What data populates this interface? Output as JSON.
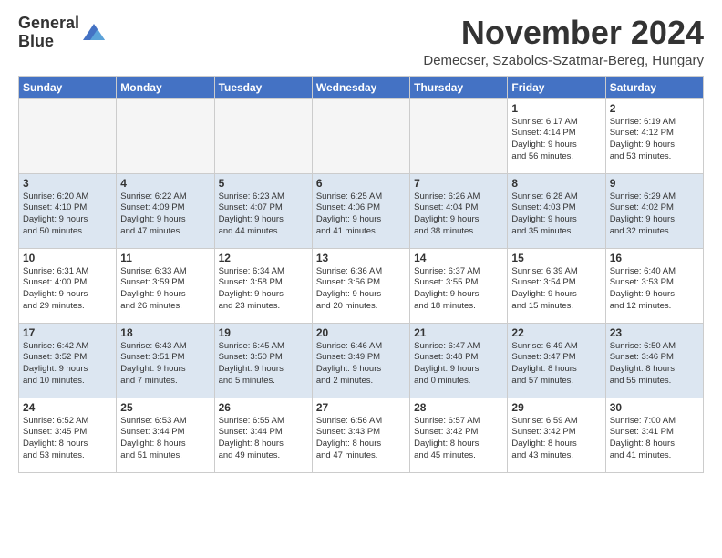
{
  "header": {
    "logo_line1": "General",
    "logo_line2": "Blue",
    "month": "November 2024",
    "location": "Demecser, Szabolcs-Szatmar-Bereg, Hungary"
  },
  "weekdays": [
    "Sunday",
    "Monday",
    "Tuesday",
    "Wednesday",
    "Thursday",
    "Friday",
    "Saturday"
  ],
  "weeks": [
    [
      {
        "day": "",
        "info": ""
      },
      {
        "day": "",
        "info": ""
      },
      {
        "day": "",
        "info": ""
      },
      {
        "day": "",
        "info": ""
      },
      {
        "day": "",
        "info": ""
      },
      {
        "day": "1",
        "info": "Sunrise: 6:17 AM\nSunset: 4:14 PM\nDaylight: 9 hours\nand 56 minutes."
      },
      {
        "day": "2",
        "info": "Sunrise: 6:19 AM\nSunset: 4:12 PM\nDaylight: 9 hours\nand 53 minutes."
      }
    ],
    [
      {
        "day": "3",
        "info": "Sunrise: 6:20 AM\nSunset: 4:10 PM\nDaylight: 9 hours\nand 50 minutes."
      },
      {
        "day": "4",
        "info": "Sunrise: 6:22 AM\nSunset: 4:09 PM\nDaylight: 9 hours\nand 47 minutes."
      },
      {
        "day": "5",
        "info": "Sunrise: 6:23 AM\nSunset: 4:07 PM\nDaylight: 9 hours\nand 44 minutes."
      },
      {
        "day": "6",
        "info": "Sunrise: 6:25 AM\nSunset: 4:06 PM\nDaylight: 9 hours\nand 41 minutes."
      },
      {
        "day": "7",
        "info": "Sunrise: 6:26 AM\nSunset: 4:04 PM\nDaylight: 9 hours\nand 38 minutes."
      },
      {
        "day": "8",
        "info": "Sunrise: 6:28 AM\nSunset: 4:03 PM\nDaylight: 9 hours\nand 35 minutes."
      },
      {
        "day": "9",
        "info": "Sunrise: 6:29 AM\nSunset: 4:02 PM\nDaylight: 9 hours\nand 32 minutes."
      }
    ],
    [
      {
        "day": "10",
        "info": "Sunrise: 6:31 AM\nSunset: 4:00 PM\nDaylight: 9 hours\nand 29 minutes."
      },
      {
        "day": "11",
        "info": "Sunrise: 6:33 AM\nSunset: 3:59 PM\nDaylight: 9 hours\nand 26 minutes."
      },
      {
        "day": "12",
        "info": "Sunrise: 6:34 AM\nSunset: 3:58 PM\nDaylight: 9 hours\nand 23 minutes."
      },
      {
        "day": "13",
        "info": "Sunrise: 6:36 AM\nSunset: 3:56 PM\nDaylight: 9 hours\nand 20 minutes."
      },
      {
        "day": "14",
        "info": "Sunrise: 6:37 AM\nSunset: 3:55 PM\nDaylight: 9 hours\nand 18 minutes."
      },
      {
        "day": "15",
        "info": "Sunrise: 6:39 AM\nSunset: 3:54 PM\nDaylight: 9 hours\nand 15 minutes."
      },
      {
        "day": "16",
        "info": "Sunrise: 6:40 AM\nSunset: 3:53 PM\nDaylight: 9 hours\nand 12 minutes."
      }
    ],
    [
      {
        "day": "17",
        "info": "Sunrise: 6:42 AM\nSunset: 3:52 PM\nDaylight: 9 hours\nand 10 minutes."
      },
      {
        "day": "18",
        "info": "Sunrise: 6:43 AM\nSunset: 3:51 PM\nDaylight: 9 hours\nand 7 minutes."
      },
      {
        "day": "19",
        "info": "Sunrise: 6:45 AM\nSunset: 3:50 PM\nDaylight: 9 hours\nand 5 minutes."
      },
      {
        "day": "20",
        "info": "Sunrise: 6:46 AM\nSunset: 3:49 PM\nDaylight: 9 hours\nand 2 minutes."
      },
      {
        "day": "21",
        "info": "Sunrise: 6:47 AM\nSunset: 3:48 PM\nDaylight: 9 hours\nand 0 minutes."
      },
      {
        "day": "22",
        "info": "Sunrise: 6:49 AM\nSunset: 3:47 PM\nDaylight: 8 hours\nand 57 minutes."
      },
      {
        "day": "23",
        "info": "Sunrise: 6:50 AM\nSunset: 3:46 PM\nDaylight: 8 hours\nand 55 minutes."
      }
    ],
    [
      {
        "day": "24",
        "info": "Sunrise: 6:52 AM\nSunset: 3:45 PM\nDaylight: 8 hours\nand 53 minutes."
      },
      {
        "day": "25",
        "info": "Sunrise: 6:53 AM\nSunset: 3:44 PM\nDaylight: 8 hours\nand 51 minutes."
      },
      {
        "day": "26",
        "info": "Sunrise: 6:55 AM\nSunset: 3:44 PM\nDaylight: 8 hours\nand 49 minutes."
      },
      {
        "day": "27",
        "info": "Sunrise: 6:56 AM\nSunset: 3:43 PM\nDaylight: 8 hours\nand 47 minutes."
      },
      {
        "day": "28",
        "info": "Sunrise: 6:57 AM\nSunset: 3:42 PM\nDaylight: 8 hours\nand 45 minutes."
      },
      {
        "day": "29",
        "info": "Sunrise: 6:59 AM\nSunset: 3:42 PM\nDaylight: 8 hours\nand 43 minutes."
      },
      {
        "day": "30",
        "info": "Sunrise: 7:00 AM\nSunset: 3:41 PM\nDaylight: 8 hours\nand 41 minutes."
      }
    ]
  ]
}
